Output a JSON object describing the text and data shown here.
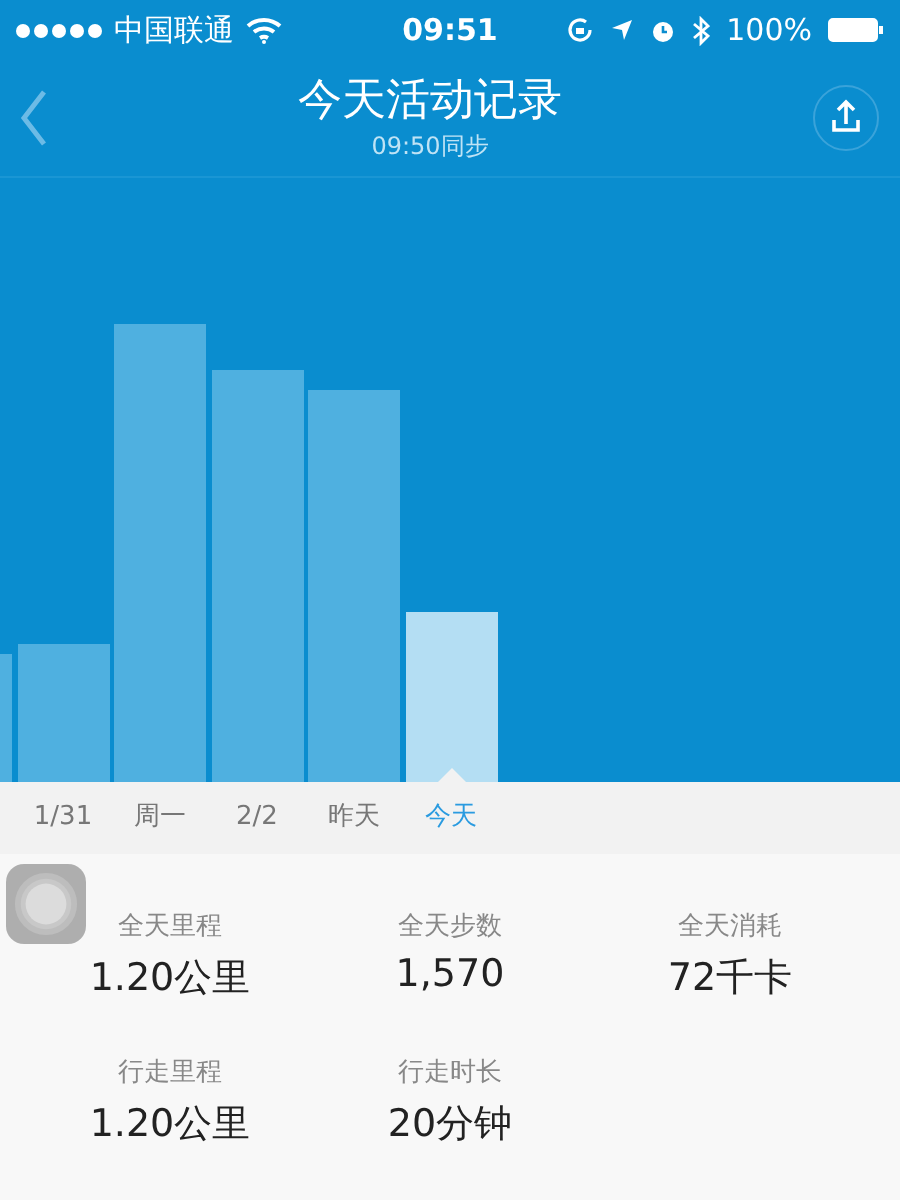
{
  "status_bar": {
    "carrier": "中国联通",
    "time": "09:51",
    "battery": "100%"
  },
  "nav": {
    "title": "今天活动记录",
    "subtitle": "09:50同步"
  },
  "days": [
    {
      "label": "1/31",
      "selected": false
    },
    {
      "label": "周一",
      "selected": false
    },
    {
      "label": "2/2",
      "selected": false
    },
    {
      "label": "昨天",
      "selected": false
    },
    {
      "label": "今天",
      "selected": true
    }
  ],
  "stats": [
    {
      "label": "全天里程",
      "value": "1.20公里"
    },
    {
      "label": "全天步数",
      "value": "1,570"
    },
    {
      "label": "全天消耗",
      "value": "72千卡"
    },
    {
      "label": "行走里程",
      "value": "1.20公里"
    },
    {
      "label": "行走时长",
      "value": "20分钟"
    }
  ]
}
